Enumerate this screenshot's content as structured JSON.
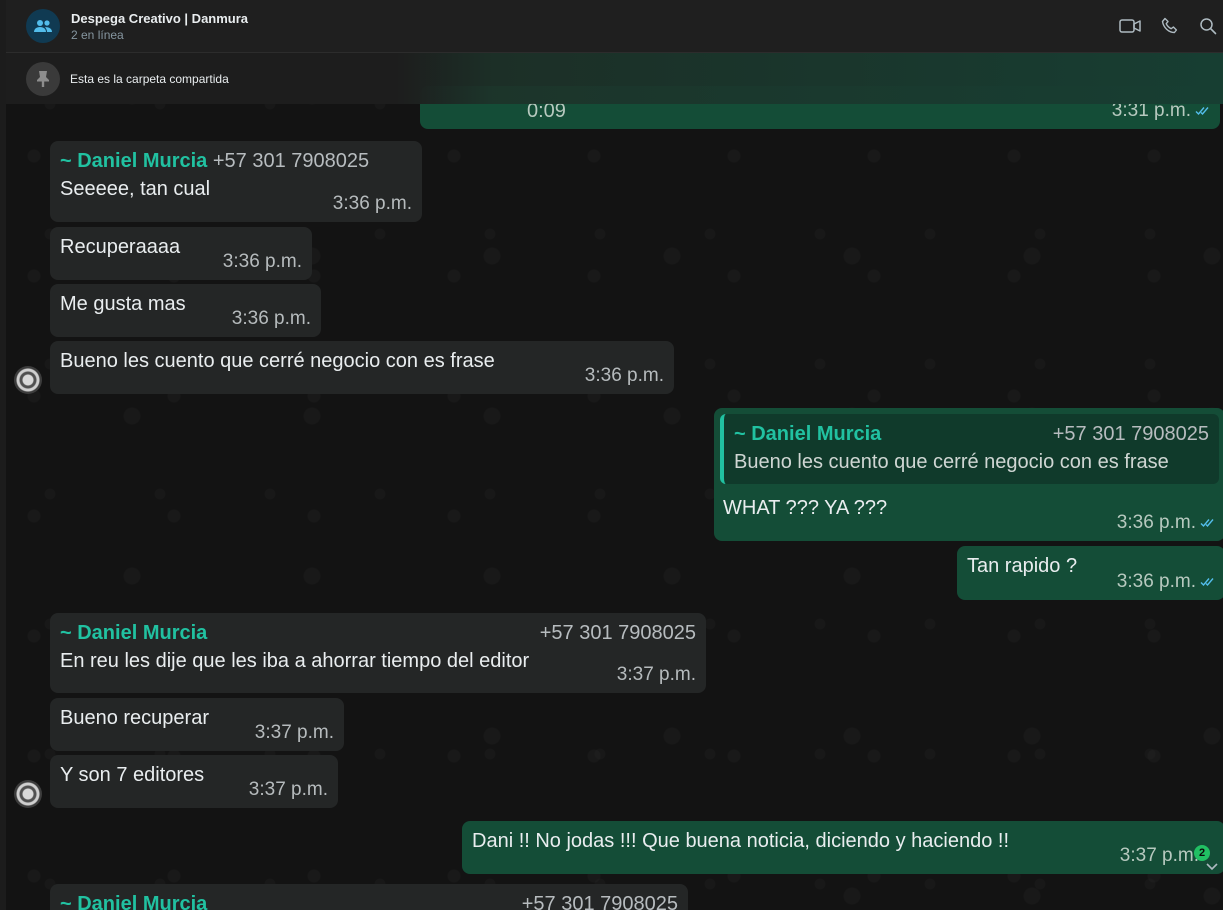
{
  "header": {
    "title": "Despega Creativo | Danmura",
    "status": "2 en línea",
    "icons": [
      "video-call-icon",
      "voice-call-icon",
      "search-icon"
    ]
  },
  "pinned": {
    "text": "Esta es la carpeta compartida",
    "icon": "pin-icon"
  },
  "messages": [
    {
      "id": "m0",
      "dir": "out",
      "text": "0:09",
      "time": "3:31 p.m.",
      "read": true
    },
    {
      "id": "m1",
      "dir": "in",
      "sender": "~ Daniel Murcia",
      "phone": "+57 301 7908025",
      "text": "Seeeee, tan cual",
      "time": "3:36 p.m."
    },
    {
      "id": "m2",
      "dir": "in",
      "text": "Recuperaaaa",
      "time": "3:36 p.m."
    },
    {
      "id": "m3",
      "dir": "in",
      "text": "Me gusta mas",
      "time": "3:36 p.m."
    },
    {
      "id": "m4",
      "dir": "in",
      "text": "Bueno les cuento que cerré negocio con es frase",
      "time": "3:36 p.m."
    },
    {
      "id": "m5",
      "dir": "out",
      "quote_sender": "~ Daniel Murcia",
      "quote_phone": "+57 301 7908025",
      "quote_text": "Bueno les cuento que cerré negocio con es frase",
      "text": "WHAT ??? YA ???",
      "time": "3:36 p.m.",
      "read": true
    },
    {
      "id": "m6",
      "dir": "out",
      "text": "Tan rapido ?",
      "time": "3:36 p.m.",
      "read": true
    },
    {
      "id": "m7",
      "dir": "in",
      "sender": "~ Daniel Murcia",
      "phone": "+57 301 7908025",
      "text": "En reu les dije que les iba a ahorrar tiempo del editor",
      "time": "3:37 p.m."
    },
    {
      "id": "m8",
      "dir": "in",
      "text": "Bueno recuperar",
      "time": "3:37 p.m."
    },
    {
      "id": "m9",
      "dir": "in",
      "text": "Y son 7 editores",
      "time": "3:37 p.m."
    },
    {
      "id": "m10",
      "dir": "out",
      "text": "Dani !! No jodas !!! Que buena noticia, diciendo y haciendo  !!",
      "time": "3:37 p.m.",
      "unread_badge": "2"
    },
    {
      "id": "m11",
      "dir": "in",
      "sender": "~ Daniel Murcia",
      "phone": "+57 301 7908025"
    }
  ]
}
